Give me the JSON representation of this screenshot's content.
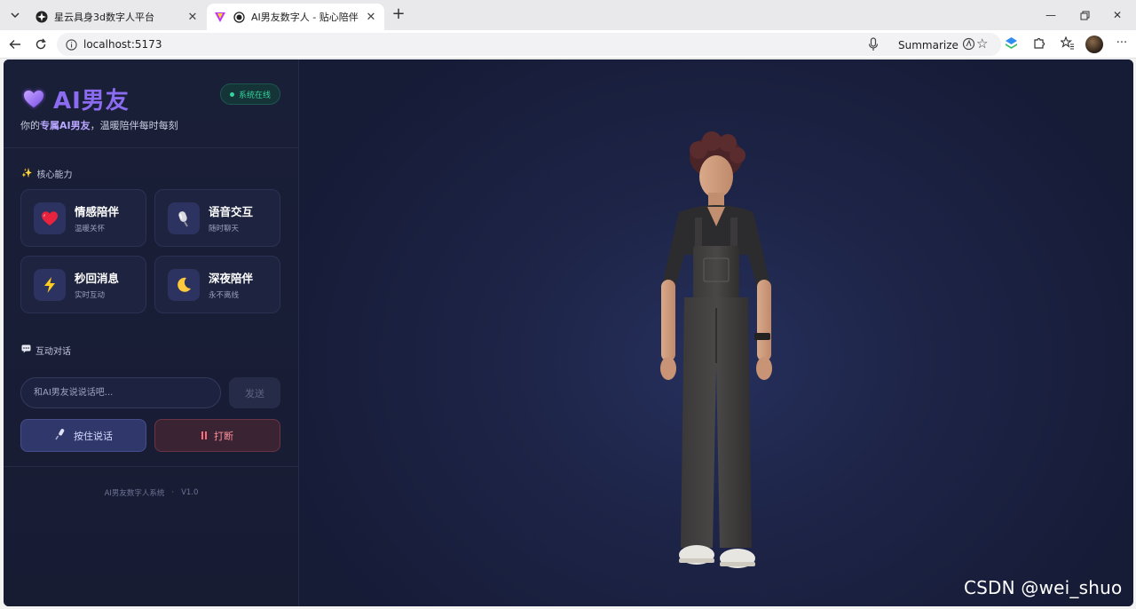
{
  "browser": {
    "tabs": [
      {
        "title": "星云具身3d数字人平台",
        "active": false
      },
      {
        "title": "AI男友数字人 - 贴心陪伴",
        "active": true
      }
    ],
    "url": "localhost:5173",
    "summarize_label": "Summarize"
  },
  "sidebar": {
    "brand_title": "AI男友",
    "status": "系统在线",
    "tagline_prefix": "你的",
    "tagline_highlight": "专属AI男友",
    "tagline_suffix": "，温暖陪伴每时每刻",
    "abilities_title": "核心能力",
    "abilities": [
      {
        "title": "情感陪伴",
        "sub": "温暖关怀",
        "icon": "heart-icon"
      },
      {
        "title": "语音交互",
        "sub": "随时聊天",
        "icon": "microphone-icon"
      },
      {
        "title": "秒回消息",
        "sub": "实时互动",
        "icon": "lightning-icon"
      },
      {
        "title": "深夜陪伴",
        "sub": "永不离线",
        "icon": "moon-icon"
      }
    ],
    "chat_title": "互动对话",
    "chat_placeholder": "和AI男友说说话吧...",
    "send_label": "发送",
    "talk_label": "按住说话",
    "stop_label": "打断",
    "footer_name": "AI男友数字人系统",
    "footer_sep": "·",
    "footer_version": "V1.0"
  },
  "watermark": "CSDN @wei_shuo",
  "colors": {
    "brand_purple": "#8b6cf0",
    "status_green": "#34d39c",
    "stop_red": "#ff8e98"
  }
}
